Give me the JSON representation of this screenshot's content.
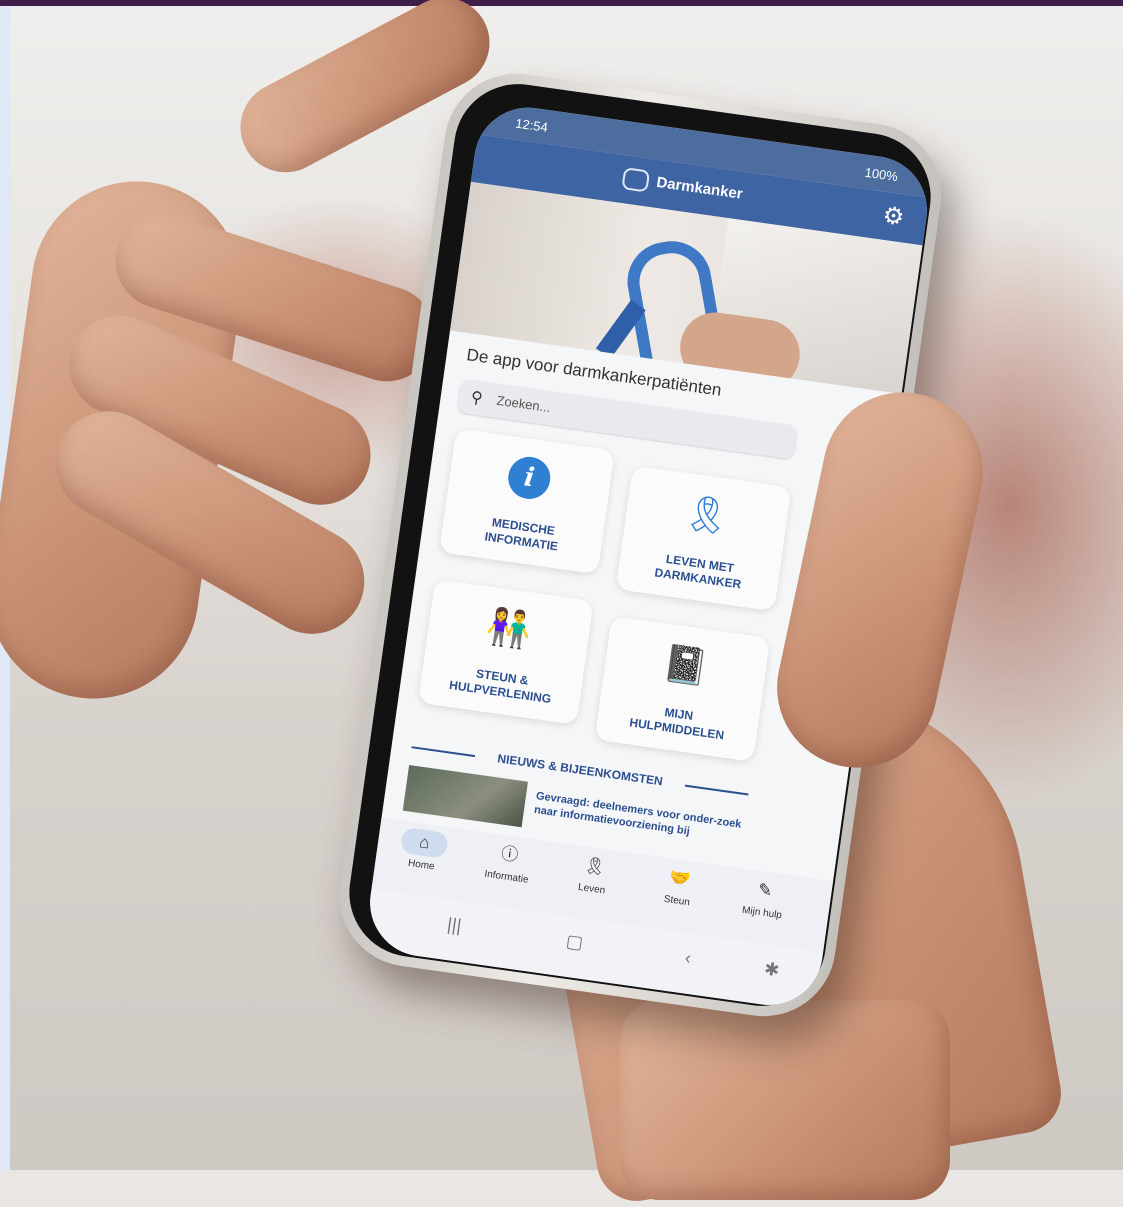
{
  "status_bar": {
    "time": "12:54",
    "right": "100%"
  },
  "app_bar": {
    "title": "Darmkanker"
  },
  "main": {
    "tagline": "De app voor darmkankerpatiënten",
    "search_placeholder": "Zoeken..."
  },
  "tiles": [
    {
      "label_line1": "MEDISCHE",
      "label_line2": "INFORMATIE",
      "icon": "info-icon"
    },
    {
      "label_line1": "LEVEN MET",
      "label_line2": "DARMKANKER",
      "icon": "ribbon-icon"
    },
    {
      "label_line1": "STEUN &",
      "label_line2": "HULPVERLENING",
      "icon": "people-support-icon"
    },
    {
      "label_line1": "MIJN",
      "label_line2": "HULPMIDDELEN",
      "icon": "notebook-pencil-icon"
    }
  ],
  "news": {
    "header": "NIEUWS & BIJEENKOMSTEN",
    "item_text": "Gevraagd: deelnemers voor onder-zoek naar informatievoorziening bij"
  },
  "bottom_nav": [
    {
      "label": "Home",
      "icon": "home-icon",
      "active": true
    },
    {
      "label": "Informatie",
      "icon": "info-outline-icon",
      "active": false
    },
    {
      "label": "Leven",
      "icon": "ribbon-icon",
      "active": false
    },
    {
      "label": "Steun",
      "icon": "handshake-icon",
      "active": false
    },
    {
      "label": "Mijn hulp",
      "icon": "edit-note-icon",
      "active": false
    }
  ],
  "colors": {
    "app_bar": "#3f64a4",
    "accent_blue": "#2f7fd3",
    "label_blue": "#2b4f8f"
  }
}
